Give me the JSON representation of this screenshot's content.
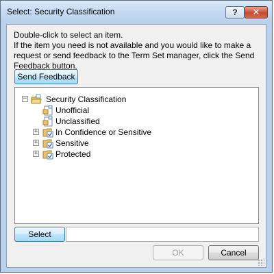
{
  "window": {
    "title": "Select: Security Classification",
    "help_label": "?",
    "close_label": "✕"
  },
  "instructions": {
    "line1": "Double-click to select an item.",
    "line2": "If the item you need is not available and you would like to make a request or send feedback to the Term Set manager, click the Send Feedback button."
  },
  "buttons": {
    "send_feedback": "Send Feedback",
    "select": "Select",
    "ok": "OK",
    "cancel": "Cancel"
  },
  "tree": {
    "root": {
      "label": "Security Classification",
      "expander": "−",
      "icon": "term-set-icon"
    },
    "items": [
      {
        "label": "Unofficial",
        "icon": "term-icon",
        "expandable": false
      },
      {
        "label": "Unclassified",
        "icon": "term-icon",
        "expandable": false
      },
      {
        "label": "In Confidence or Sensitive",
        "icon": "term-folder-icon",
        "expandable": true,
        "expander": "+"
      },
      {
        "label": "Sensitive",
        "icon": "term-folder-icon",
        "expandable": true,
        "expander": "+"
      },
      {
        "label": "Protected",
        "icon": "term-folder-icon",
        "expandable": true,
        "expander": "+"
      }
    ]
  },
  "select_field": {
    "value": ""
  },
  "colors": {
    "titlebar": "#c7dcf3",
    "dialog_bg": "#f0f0f0",
    "close_button": "#c74a2f",
    "focus_button": "#a7d9f5"
  }
}
